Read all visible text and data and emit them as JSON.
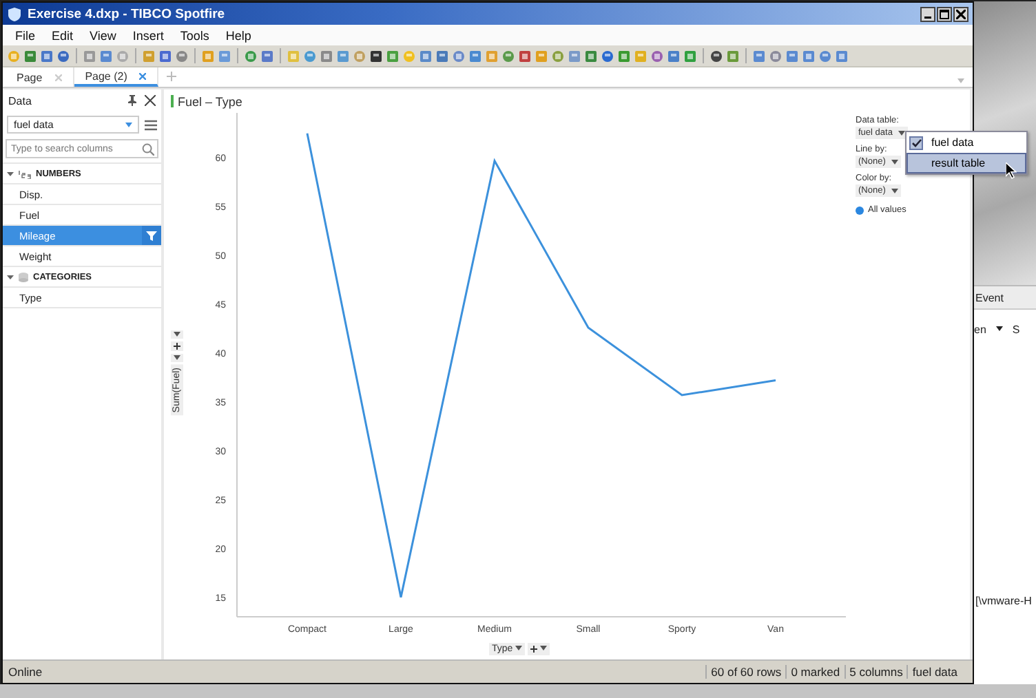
{
  "window": {
    "title": "Exercise 4.dxp - TIBCO Spotfire"
  },
  "menu": [
    "File",
    "Edit",
    "View",
    "Insert",
    "Tools",
    "Help"
  ],
  "tabs": [
    {
      "label": "Page",
      "selected": false
    },
    {
      "label": "Page (2)",
      "selected": true
    }
  ],
  "data_panel": {
    "title": "Data",
    "table": "fuel data",
    "search": {
      "placeholder": "Type to search columns"
    },
    "groups": [
      {
        "label": "NUMBERS",
        "kind": "numbers",
        "expanded": true,
        "children": [
          {
            "label": "Disp.",
            "selected": false
          },
          {
            "label": "Fuel",
            "selected": false
          },
          {
            "label": "Mileage",
            "selected": true
          },
          {
            "label": "Weight",
            "selected": false
          }
        ]
      },
      {
        "label": "CATEGORIES",
        "kind": "categories",
        "expanded": true,
        "children": [
          {
            "label": "Type",
            "selected": false
          }
        ]
      }
    ]
  },
  "visualization": {
    "title": "Fuel – Type",
    "x_axis": "Type",
    "chart_data": {
      "type": "line",
      "categories": [
        "Compact",
        "Large",
        "Medium",
        "Small",
        "Sporty",
        "Van"
      ],
      "series": [
        {
          "name": "Sum(Fuel)",
          "color": "#3c91dc",
          "values": [
            62.5,
            15,
            59.7,
            42.6,
            35.7,
            37.2
          ]
        }
      ],
      "ylim": [
        13,
        64.6
      ],
      "yticks": [
        15,
        20,
        25,
        30,
        35,
        40,
        45,
        50,
        55,
        60
      ]
    }
  },
  "legend": {
    "data_table_label": "Data table:",
    "data_table": "fuel data",
    "line_by_label": "Line by:",
    "line_by": "(None)",
    "color_by_label": "Color by:",
    "color_by": "(None)",
    "items": [
      {
        "label": "All values",
        "color": "#2b87e0"
      }
    ]
  },
  "dropdown": {
    "items": [
      {
        "label": "fuel data",
        "checked": true,
        "selected": false
      },
      {
        "label": "result table",
        "checked": false,
        "selected": true
      }
    ]
  },
  "status_bar": {
    "left": "Online",
    "items": [
      "60 of 60 rows",
      "0 marked",
      "5 columns",
      "fuel data"
    ]
  },
  "background_window": {
    "tab": "Event",
    "texts": [
      "en",
      "S"
    ],
    "path": "[\\vmware-H"
  }
}
